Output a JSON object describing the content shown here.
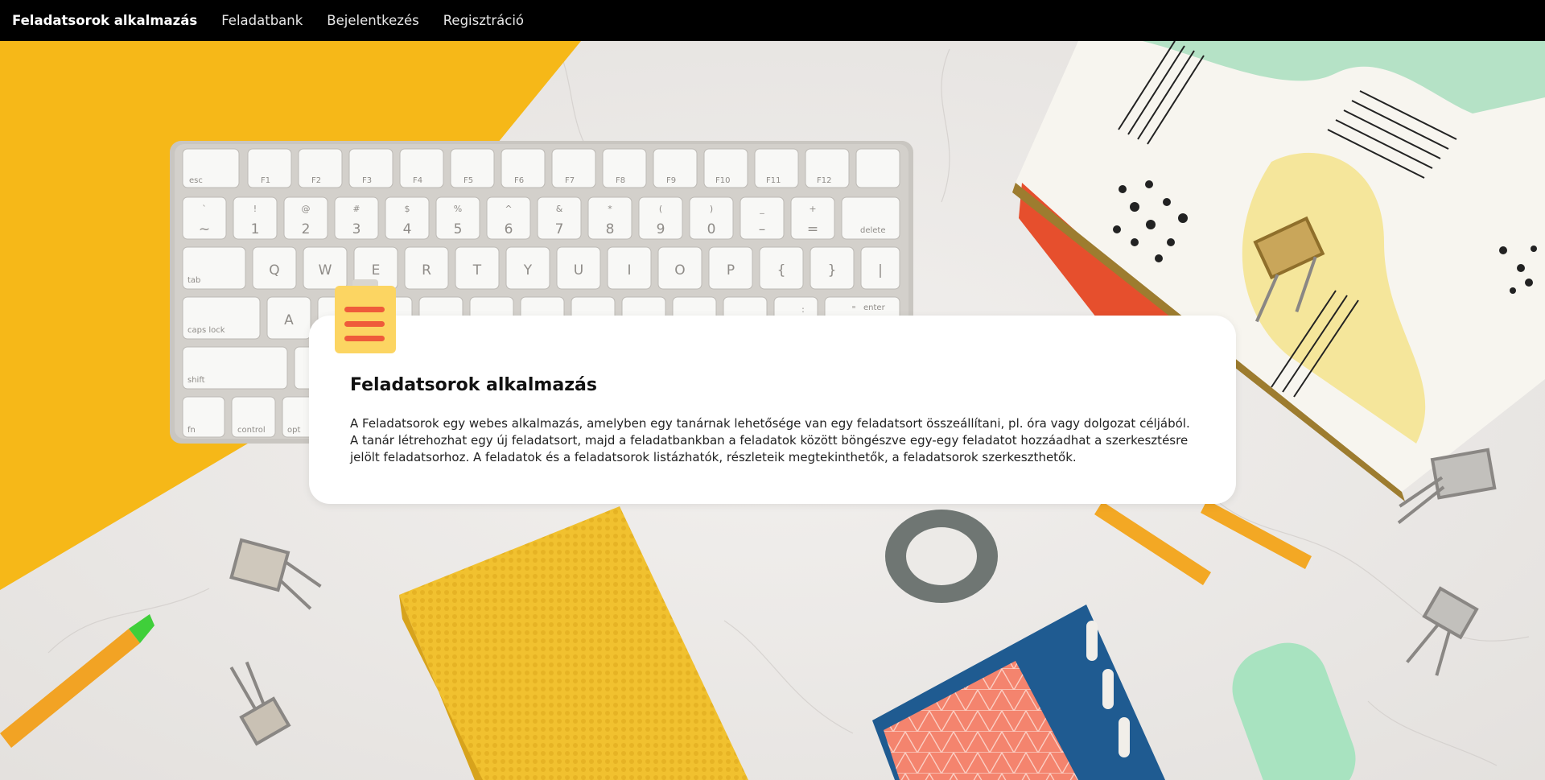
{
  "navbar": {
    "brand": "Feladatsorok alkalmazás",
    "links": [
      "Feladatbank",
      "Bejelentkezés",
      "Regisztráció"
    ]
  },
  "card": {
    "title": "Feladatsorok alkalmazás",
    "description": "A Feladatsorok egy webes alkalmazás, amelyben egy tanárnak lehetősége van egy feladatsort összeállítani, pl. óra vagy dolgozat céljából. A tanár létrehozhat egy új feladatsort, majd a feladatbankban a feladatok között böngészve egy-egy feladatot hozzáadhat a szerkesztésre jelölt feladatsorhoz. A feladatok és a feladatsorok listázhatók, részleteik megtekinthetők, a feladatsorok szerkeszthetők.",
    "icon": "clipboard-list-icon"
  },
  "keyboard": {
    "fn_row": [
      "esc",
      "F1",
      "F2",
      "F3",
      "F4",
      "F5",
      "F6",
      "F7",
      "F8",
      "F9",
      "F10",
      "F11",
      "F12",
      ""
    ],
    "num_row": [
      "~",
      "1",
      "2",
      "3",
      "4",
      "5",
      "6",
      "7",
      "8",
      "9",
      "0",
      "–",
      "=",
      "delete"
    ],
    "num_row_top": [
      "`",
      "!",
      "@",
      "#",
      "$",
      "%",
      "^",
      "&",
      "*",
      "(",
      ")",
      "_",
      "+",
      ""
    ],
    "top_row": [
      "tab",
      "Q",
      "W",
      "E",
      "R",
      "T",
      "Y",
      "U",
      "I",
      "O",
      "P",
      "{",
      "}",
      "|"
    ],
    "home_row": [
      "caps lock",
      "A",
      "",
      "",
      "",
      "",
      "",
      "",
      "",
      "",
      ":",
      "\"",
      "enter"
    ],
    "shift_row": [
      "shift"
    ],
    "bottom_row": [
      "fn",
      "control",
      "opt"
    ]
  },
  "colors": {
    "navbar_bg": "#000000",
    "yellow_paper": "#f6b818",
    "notebook_yellow": "#f3c233",
    "card_bg": "#ffffff",
    "icon_yellow": "#fcd562",
    "icon_red": "#ef5b3a"
  }
}
